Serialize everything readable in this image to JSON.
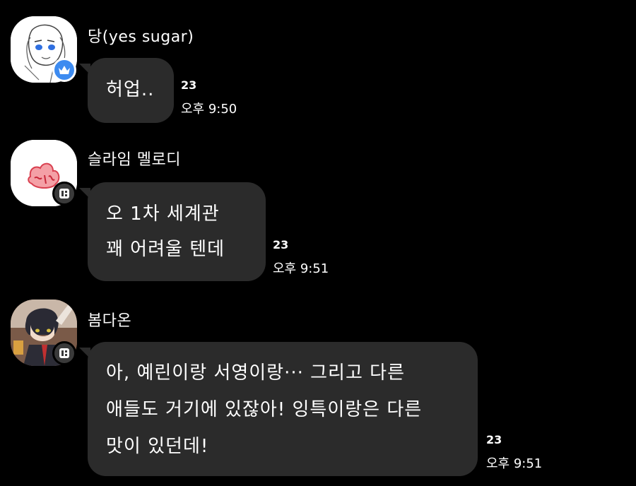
{
  "messages": [
    {
      "sender": "당(yes sugar)",
      "avatar": "doodle-avatar",
      "badge": "crown-icon",
      "lines": [
        "허업.."
      ],
      "unread": "23",
      "time": "오후 9:50"
    },
    {
      "sender": "슬라임 멜로디",
      "avatar": "slime-avatar",
      "badge": "staff-icon",
      "lines": [
        "오 1차 세계관",
        "꽤 어려울 텐데"
      ],
      "unread": "23",
      "time": "오후 9:51"
    },
    {
      "sender": "봄다온",
      "avatar": "anime-character-avatar",
      "badge": "staff-icon",
      "lines": [
        "아, 예린이랑 서영이랑··· 그리고 다른",
        "애들도 거기에 있잖아! 잉특이랑은 다른",
        "맛이 있던데!"
      ],
      "unread": "23",
      "time": "오후 9:51"
    }
  ],
  "colors": {
    "background": "#000000",
    "bubble": "#2b2b2b",
    "crown_badge": "#3d8bf0",
    "text": "#ffffff"
  }
}
